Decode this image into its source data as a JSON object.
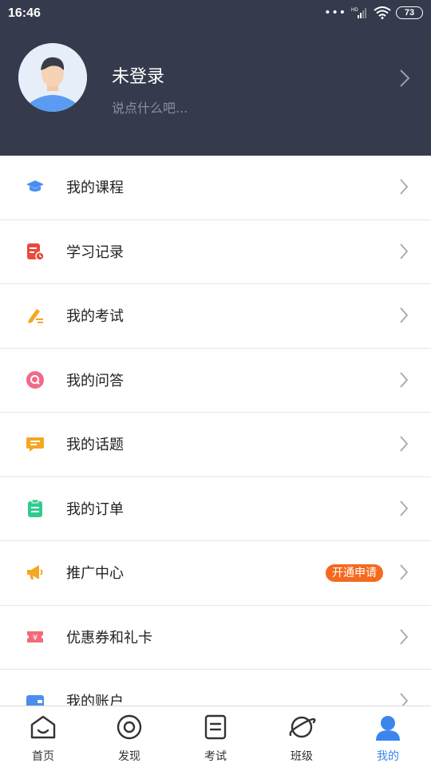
{
  "status_bar": {
    "time": "16:46",
    "battery": "73",
    "network": "HD"
  },
  "profile": {
    "name": "未登录",
    "signature": "说点什么吧..."
  },
  "menu": [
    {
      "label": "我的课程",
      "icon": "graduation-cap-icon",
      "color": "#4a8ff0"
    },
    {
      "label": "学习记录",
      "icon": "study-record-icon",
      "color": "#e84a3c"
    },
    {
      "label": "我的考试",
      "icon": "pencil-exam-icon",
      "color": "#f5a623"
    },
    {
      "label": "我的问答",
      "icon": "qa-icon",
      "color": "#f06b8a"
    },
    {
      "label": "我的话题",
      "icon": "topic-chat-icon",
      "color": "#f5a623"
    },
    {
      "label": "我的订单",
      "icon": "order-clipboard-icon",
      "color": "#2ecc8f"
    },
    {
      "label": "推广中心",
      "icon": "megaphone-icon",
      "color": "#f5a623",
      "badge": "开通申请"
    },
    {
      "label": "优惠券和礼卡",
      "icon": "coupon-icon",
      "color": "#f06b7a"
    },
    {
      "label": "我的账户",
      "icon": "wallet-icon",
      "color": "#4a8ff0"
    }
  ],
  "bottom_nav": [
    {
      "label": "首页",
      "icon": "home-icon",
      "active": false
    },
    {
      "label": "发现",
      "icon": "discover-icon",
      "active": false
    },
    {
      "label": "考试",
      "icon": "exam-icon",
      "active": false
    },
    {
      "label": "班级",
      "icon": "class-planet-icon",
      "active": false
    },
    {
      "label": "我的",
      "icon": "profile-user-icon",
      "active": true
    }
  ],
  "colors": {
    "header_bg": "#353a4d",
    "accent": "#3a86ee",
    "badge": "#f46a1f"
  }
}
